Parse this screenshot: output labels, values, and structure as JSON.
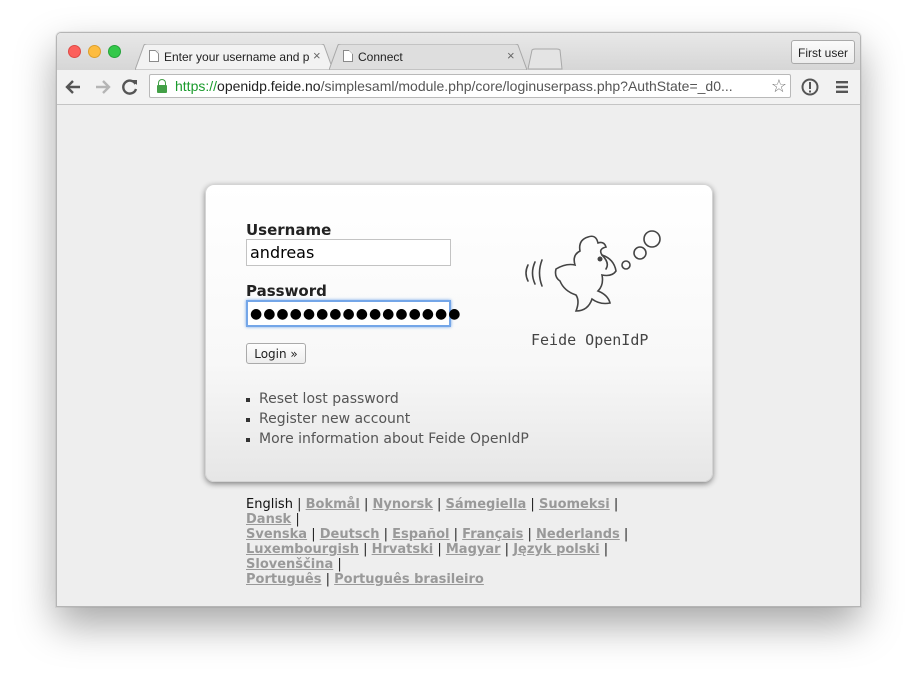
{
  "browser": {
    "tabs": [
      {
        "title": "Enter your username and p",
        "active": true
      },
      {
        "title": "Connect",
        "active": false
      }
    ],
    "profile_button": "First user",
    "url": {
      "scheme": "https://",
      "host": "openidp.feide.no",
      "path": "/simplesaml/module.php/core/loginuserpass.php?AuthState=_d0..."
    },
    "close_glyph": "×"
  },
  "login": {
    "username_label": "Username",
    "username_value": "andreas",
    "password_label": "Password",
    "password_masked": "●●●●●●●●●●●●●●●●",
    "login_button": "Login »",
    "links": [
      "Reset lost password",
      "Register new account",
      "More information about Feide OpenIdP"
    ],
    "logo_text": "Feide OpenIdP"
  },
  "languages": {
    "current": "English",
    "others": [
      "Bokmål",
      "Nynorsk",
      "Sámegiella",
      "Suomeksi",
      "Dansk",
      "Svenska",
      "Deutsch",
      "Español",
      "Français",
      "Nederlands",
      "Luxembourgish",
      "Hrvatski",
      "Magyar",
      "Język polski",
      "Slovenščina",
      "Português",
      "Português brasileiro"
    ]
  },
  "colors": {
    "url_scheme": "#1a9b2c",
    "focus_ring": "#74a6e8",
    "lang_link": "#999999"
  }
}
